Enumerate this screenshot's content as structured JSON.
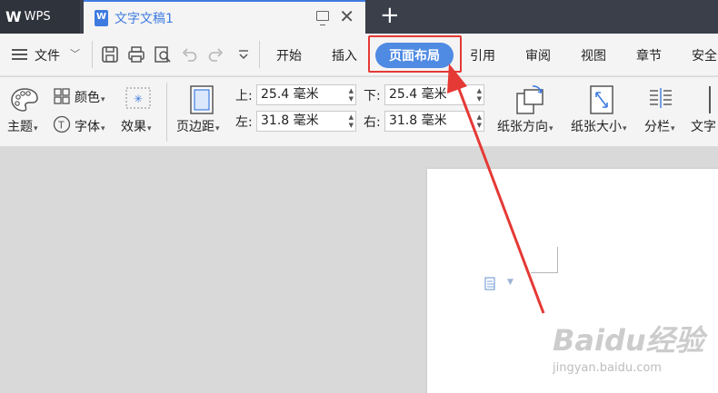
{
  "app": {
    "name": "WPS",
    "logo": "W"
  },
  "document": {
    "title": "文字文稿1"
  },
  "menu": {
    "file": "文件",
    "items": [
      "开始",
      "插入",
      "页面布局",
      "引用",
      "审阅",
      "视图",
      "章节",
      "安全"
    ],
    "active": "页面布局"
  },
  "ribbon": {
    "theme": "主题",
    "color": "颜色",
    "font": "字体",
    "effect": "效果",
    "margins": "页边距",
    "top_label": "上:",
    "top_value": "25.4 毫米",
    "bottom_label": "下:",
    "bottom_value": "25.4 毫米",
    "left_label": "左:",
    "left_value": "31.8 毫米",
    "right_label": "右:",
    "right_value": "31.8 毫米",
    "orientation": "纸张方向",
    "size": "纸张大小",
    "columns": "分栏",
    "text_direction": "文字"
  },
  "watermark": {
    "brand": "Baidu经验",
    "url": "jingyan.baidu.com"
  },
  "colors": {
    "accent": "#4f8ae3",
    "highlight": "#e53935",
    "titlebar": "#3a3f4a"
  }
}
